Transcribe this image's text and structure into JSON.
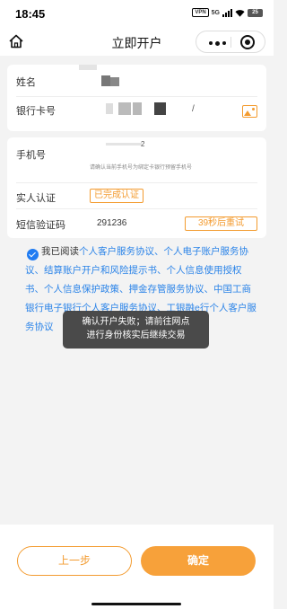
{
  "status_bar": {
    "time": "18:45",
    "vpn": "VPN",
    "network": "5G",
    "battery": "25"
  },
  "nav": {
    "title": "立即开户",
    "home_icon": "home-icon",
    "more_icon": "more-dots-icon",
    "close_icon": "mini-program-close-icon"
  },
  "form": {
    "name_label": "姓名",
    "bank_card_label": "银行卡号",
    "bank_card_suffix": "/",
    "phone_label": "手机号",
    "phone_suffix": "2",
    "phone_hint": "请确认当前手机号为绑定卡银行预留手机号",
    "verify_label": "实人认证",
    "verify_status": "已完成认证",
    "sms_label": "短信验证码",
    "sms_code": "291236",
    "resend_label": "39秒后重试"
  },
  "agreement": {
    "prefix": "我已阅读",
    "links": "个人客户服务协议、个人电子账户服务协议、结算账户开户和风险提示书、个人信息使用授权书、个人信息保护政策、押金存管服务协议、中国工商银行电子银行个人客户服务协议、工银融e行个人客户服务协议"
  },
  "toast": {
    "line1": "确认开户失败；请前往网点",
    "line2": "进行身份核实后继续交易"
  },
  "footer": {
    "prev_label": "上一步",
    "confirm_label": "确定"
  },
  "colors": {
    "accent": "#f39b2f",
    "link": "#2a83e8",
    "check": "#1f7bf2"
  }
}
